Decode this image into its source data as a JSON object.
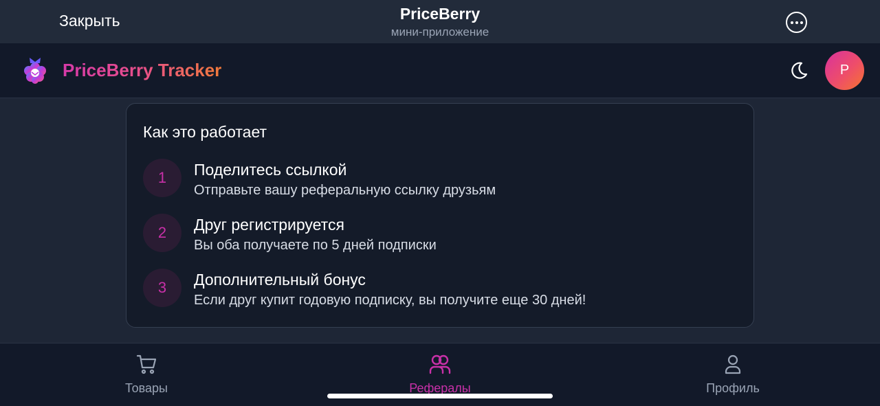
{
  "telegram": {
    "close_label": "Закрыть",
    "title": "PriceBerry",
    "subtitle": "мини-приложение",
    "more_icon": "more-horizontal-icon"
  },
  "app_header": {
    "brand": "PriceBerry Tracker",
    "theme_icon": "moon-icon",
    "avatar_letter": "P"
  },
  "how_it_works": {
    "title": "Как это работает",
    "steps": [
      {
        "num": "1",
        "title": "Поделитесь ссылкой",
        "desc": "Отправьте вашу реферальную ссылку друзьям"
      },
      {
        "num": "2",
        "title": "Друг регистрируется",
        "desc": "Вы оба получаете по 5 дней подписки"
      },
      {
        "num": "3",
        "title": "Дополнительный бонус",
        "desc": "Если друг купит годовую подписку, вы получите еще 30 дней!"
      }
    ]
  },
  "bottom_nav": {
    "items": [
      {
        "label": "Товары",
        "icon": "cart-icon",
        "active": false
      },
      {
        "label": "Рефералы",
        "icon": "users-icon",
        "active": true
      },
      {
        "label": "Профиль",
        "icon": "user-icon",
        "active": false
      }
    ]
  },
  "colors": {
    "accent": "#c830a8",
    "gradient_start": "#d63aa8",
    "gradient_end": "#f07a3a",
    "background": "#1e2636",
    "card": "#141b29"
  }
}
